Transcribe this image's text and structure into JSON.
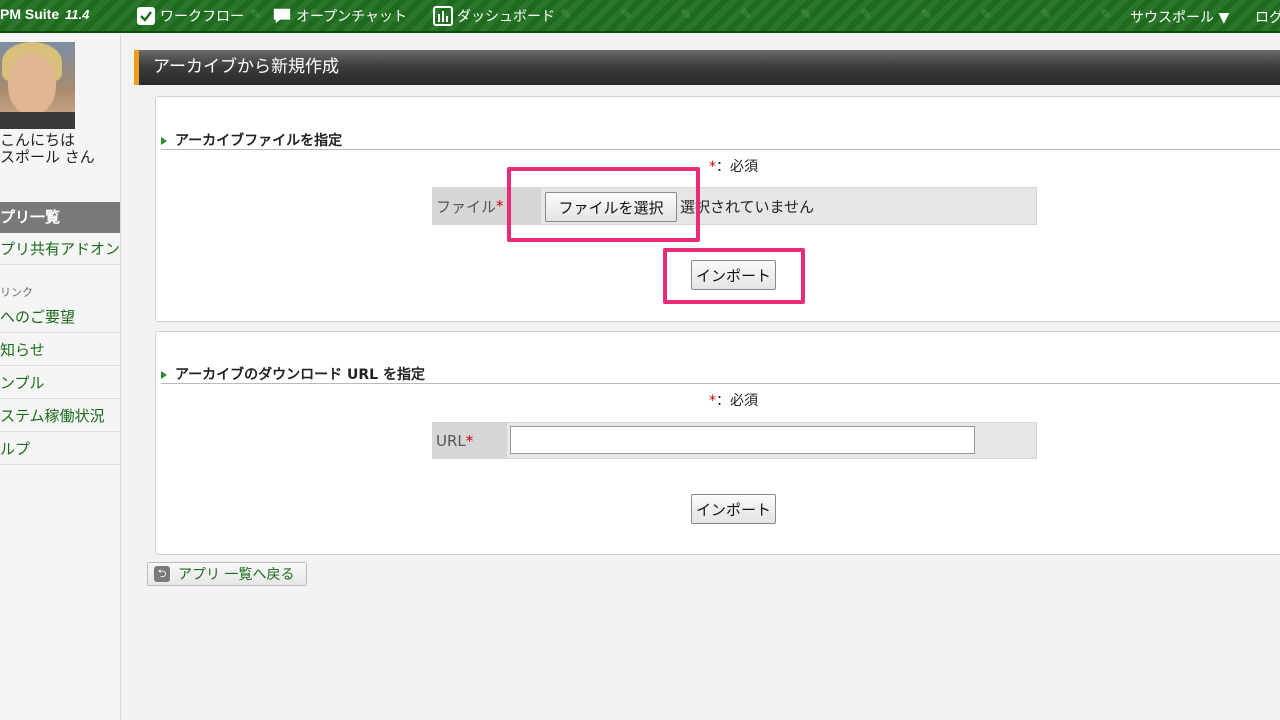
{
  "header": {
    "logo_text": "PM Suite",
    "logo_version": "11.4",
    "nav": [
      {
        "label": "ワークフロー",
        "icon": "checkbox-icon"
      },
      {
        "label": "オープンチャット",
        "icon": "chat-bubble-icon"
      },
      {
        "label": "ダッシュボード",
        "icon": "dashboard-icon"
      }
    ],
    "user_menu": "サウスポール ▼",
    "logout": "ログ"
  },
  "sidebar": {
    "greeting_line1": "こんにちは",
    "greeting_line2": "スポール さん",
    "section_title": "プリ一覧",
    "addon_link": "プリ共有アドオン",
    "links_caption": "リンク",
    "links": [
      "へのご要望",
      "知らせ",
      "ンプル",
      "ステム稼働状況",
      "ルプ"
    ]
  },
  "main": {
    "page_title": "アーカイブから新規作成",
    "file_section": {
      "heading": "アーカイブファイルを指定",
      "required_note": "：必須",
      "required_star": "*",
      "field_label": "ファイル",
      "choose_button": "ファイルを選択",
      "no_file_text": "選択されていません",
      "import_button": "インポート"
    },
    "url_section": {
      "heading": "アーカイブのダウンロード URL を指定",
      "required_note": "：必須",
      "required_star": "*",
      "field_label": "URL",
      "url_value": "",
      "import_button": "インポート"
    },
    "back_button": "アプリ 一覧へ戻る"
  },
  "colors": {
    "topbar": "#1f6f1f",
    "accent_orange": "#f29b1d",
    "highlight": "#ea2b7a",
    "link_green": "#1a6b1a"
  }
}
